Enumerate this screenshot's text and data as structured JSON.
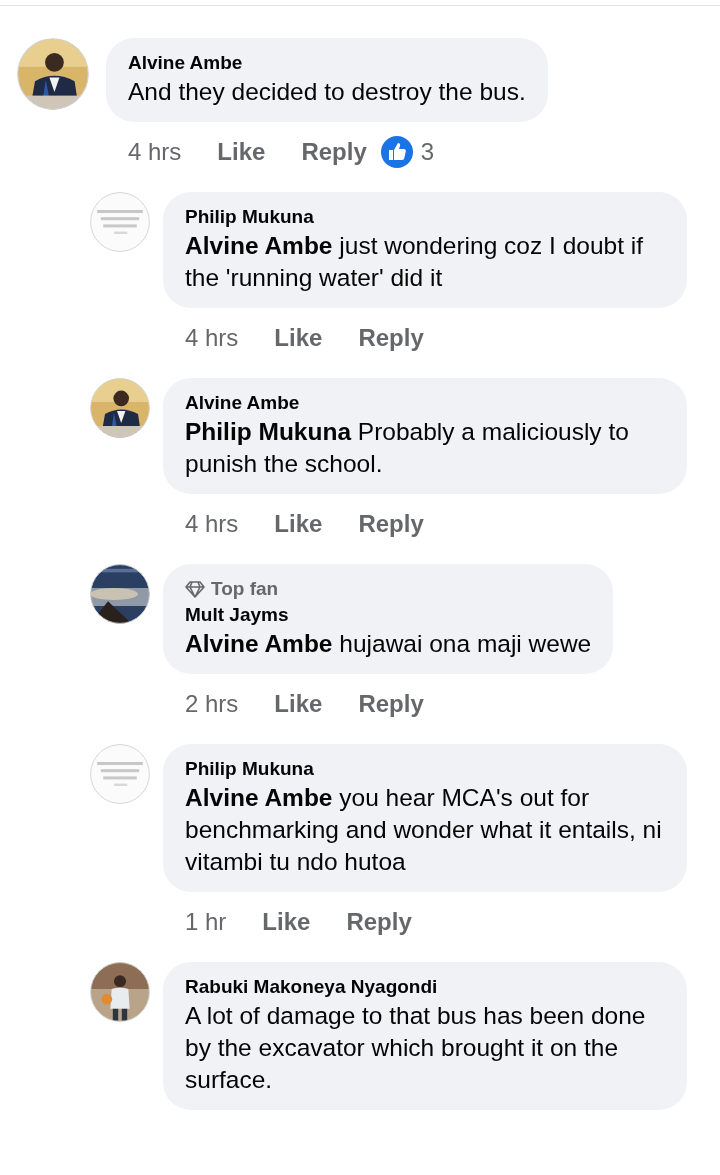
{
  "comments": [
    {
      "name": "Alvine Ambe",
      "text": "And they decided to destroy the bus.",
      "time": "4 hrs",
      "actions": [
        "Like",
        "Reply"
      ],
      "reactions": {
        "count": "3"
      },
      "children": [
        {
          "name": "Philip Mukuna",
          "text": "**Alvine Ambe** just wondering coz I doubt if the 'running water' did it",
          "time": "4 hrs",
          "actions": [
            "Like",
            "Reply"
          ]
        },
        {
          "name": "Alvine Ambe",
          "text": "**Philip Mukuna** Probably a maliciously to punish the school.",
          "time": "4 hrs",
          "actions": [
            "Like",
            "Reply"
          ]
        },
        {
          "badge": "Top fan",
          "name": "Mult Jayms",
          "text": "**Alvine Ambe** hujawai ona maji wewe",
          "time": "2 hrs",
          "actions": [
            "Like",
            "Reply"
          ]
        },
        {
          "name": "Philip Mukuna",
          "text": "**Alvine Ambe** you hear MCA's out for benchmarking and wonder what it entails, ni vitambi tu ndo hutoa",
          "time": "1 hr",
          "actions": [
            "Like",
            "Reply"
          ]
        },
        {
          "name": "Rabuki Makoneya Nyagondi",
          "text": "A lot of damage to that bus has been done by the excavator which brought it on the surface."
        }
      ]
    }
  ]
}
